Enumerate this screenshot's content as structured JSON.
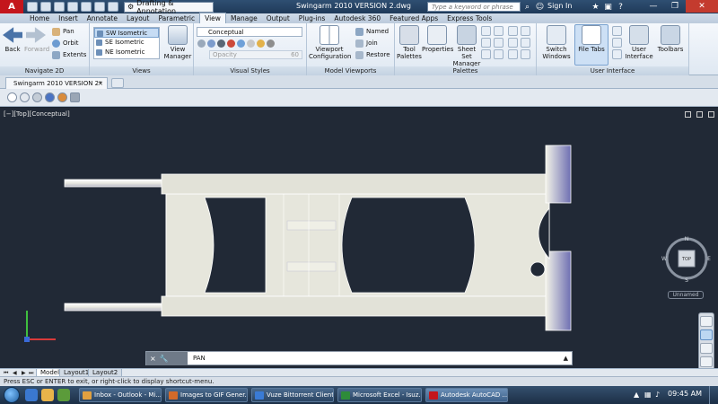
{
  "titlebar": {
    "app_logo": "A",
    "workspace": "Drafting & Annotation",
    "title": "Swingarm 2010 VERSION 2.dwg",
    "search_placeholder": "Type a keyword or phrase",
    "signin": "Sign In",
    "icons": [
      "binoculars-icon",
      "star-icon",
      "cart-icon",
      "help-icon"
    ]
  },
  "tabs": [
    "Home",
    "Insert",
    "Annotate",
    "Layout",
    "Parametric",
    "View",
    "Manage",
    "Output",
    "Plug-ins",
    "Autodesk 360",
    "Featured Apps",
    "Express Tools"
  ],
  "active_tab": "View",
  "ribbon": {
    "navigate": {
      "label": "Navigate 2D",
      "back": "Back",
      "forward": "Forward",
      "pan": "Pan",
      "orbit": "Orbit",
      "extents": "Extents"
    },
    "views": {
      "label": "Views",
      "items": [
        "SW Isometric",
        "SE Isometric",
        "NE Isometric"
      ],
      "selected": "SW Isometric",
      "view_manager": "View Manager"
    },
    "visual_styles": {
      "label": "Visual Styles",
      "style": "Conceptual",
      "opacity_label": "Opacity",
      "opacity_value": "60"
    },
    "model_viewports": {
      "label": "Model Viewports",
      "viewport_configuration": "Viewport Configuration",
      "named": "Named",
      "join": "Join",
      "restore": "Restore"
    },
    "palettes": {
      "label": "Palettes",
      "tool_palettes": "Tool Palettes",
      "properties": "Properties",
      "sheet_set_manager": "Sheet Set Manager"
    },
    "user_interface": {
      "label": "User Interface",
      "switch_windows": "Switch Windows",
      "file_tabs": "File Tabs",
      "user_interface": "User Interface",
      "toolbars": "Toolbars"
    }
  },
  "file_tab": {
    "name": "Swingarm 2010 VERSION 2*",
    "close": "×"
  },
  "viewport": {
    "label": "[−][Top][Conceptual]",
    "viewcube": {
      "top": "TOP",
      "n": "N",
      "s": "S",
      "e": "E",
      "w": "W"
    },
    "ucs_name": "Unnamed"
  },
  "command_line": {
    "close": "×",
    "settings": "🔧",
    "command": "PAN",
    "history": "▲"
  },
  "layout_tabs": [
    "Model",
    "Layout1",
    "Layout2"
  ],
  "active_layout": "Model",
  "status_text": "Press ESC or ENTER to exit, or right-click to display shortcut-menu.",
  "taskbar": {
    "tasks": [
      {
        "label": "Inbox - Outlook - Mi...",
        "color": "#e0a040"
      },
      {
        "label": "Images to GIF Gener...",
        "color": "#d26a2a"
      },
      {
        "label": "Vuze Bittorrent Client",
        "color": "#3a7bd5"
      },
      {
        "label": "Microsoft Excel - Isuz...",
        "color": "#2e8b3a"
      },
      {
        "label": "Autodesk AutoCAD ...",
        "color": "#c4161c"
      }
    ],
    "active": "Autodesk AutoCAD ...",
    "clock": "09:45 AM"
  },
  "colors": {
    "drawing_bg": "#212936",
    "part_fill": "#e6e6dc",
    "accent_blue": "#6a6fb0",
    "autocad_red": "#c4161c"
  }
}
